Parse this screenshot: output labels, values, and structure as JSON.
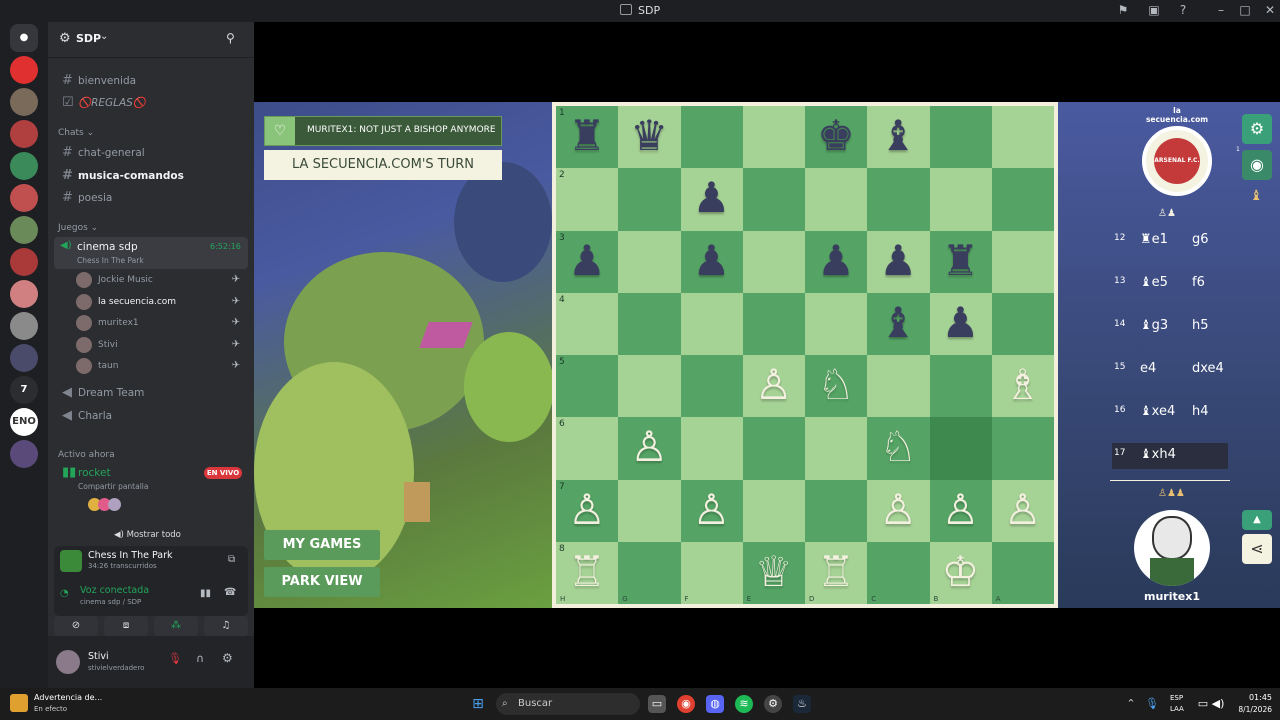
{
  "window": {
    "title": "SDP"
  },
  "server": {
    "name": "SDP"
  },
  "channels": {
    "top": [
      {
        "label": "bienvenida",
        "type": "text"
      },
      {
        "label": "🚫REGLAS🚫",
        "type": "rules"
      }
    ],
    "category_chats": "Chats",
    "chats": [
      {
        "label": "chat-general"
      },
      {
        "label": "musica-comandos"
      },
      {
        "label": "poesia"
      }
    ],
    "category_juegos": "Juegos",
    "voice_active": {
      "label": "cinema sdp",
      "sub": "Chess In The Park",
      "time": "6:52:16"
    },
    "voice_users": [
      {
        "name": "Jockie Music"
      },
      {
        "name": "la secuencia.com"
      },
      {
        "name": "muritex1"
      },
      {
        "name": "Stivi"
      },
      {
        "name": "taun"
      }
    ],
    "other_voice": [
      {
        "label": "Dream Team"
      },
      {
        "label": "Charla"
      }
    ],
    "active_header": "Activo ahora",
    "active_channel": {
      "label": "rocket",
      "sub": "Compartir pantalla",
      "badge": "EN VIVO"
    },
    "show_all": "Mostrar todo"
  },
  "activity": {
    "title": "Chess In The Park",
    "sub": "34:26 transcurridos"
  },
  "voice_status": {
    "title": "Voz conectada",
    "sub": "cinema sdp / SDP"
  },
  "user": {
    "name": "Stivi",
    "tag": "stivielverdadero"
  },
  "servers": [
    {
      "label": "",
      "color": "#e03030"
    },
    {
      "label": "",
      "color": "#7a6a5a"
    },
    {
      "label": "",
      "color": "#b04040"
    },
    {
      "label": "",
      "color": "#3a8a5a"
    },
    {
      "label": "",
      "color": "#c05050"
    },
    {
      "label": "",
      "color": "#6a8a5a"
    },
    {
      "label": "",
      "color": "#aa3a3a"
    },
    {
      "label": "",
      "color": "#d08080"
    },
    {
      "label": "",
      "color": "#8a8a8a"
    },
    {
      "label": "",
      "color": "#4a4a6a"
    },
    {
      "label": "7",
      "color": "#2b2d31"
    },
    {
      "label": "ENO",
      "color": "#fff"
    },
    {
      "label": "",
      "color": "#5a4a7a"
    }
  ],
  "game": {
    "notification": "MURITEX1: NOT JUST A BISHOP ANYMORE",
    "turn": "LA SECUENCIA.COM'S TURN",
    "my_games": "MY GAMES",
    "park_view": "PARK VIEW",
    "player_top": "la secuencia.com",
    "player_bottom": "muritex1",
    "crest_text": "ARSENAL F.C.",
    "badge_num": "1",
    "ranks": [
      "1",
      "2",
      "3",
      "4",
      "5",
      "6",
      "7",
      "8"
    ],
    "files": [
      "H",
      "G",
      "F",
      "E",
      "D",
      "C",
      "B",
      "A"
    ],
    "pieces": [
      {
        "r": 0,
        "c": 0,
        "p": "♜",
        "col": "b"
      },
      {
        "r": 0,
        "c": 1,
        "p": "♛",
        "col": "b"
      },
      {
        "r": 0,
        "c": 4,
        "p": "♚",
        "col": "b"
      },
      {
        "r": 0,
        "c": 5,
        "p": "♝",
        "col": "b"
      },
      {
        "r": 1,
        "c": 2,
        "p": "♟",
        "col": "b"
      },
      {
        "r": 2,
        "c": 0,
        "p": "♟",
        "col": "b"
      },
      {
        "r": 2,
        "c": 2,
        "p": "♟",
        "col": "b"
      },
      {
        "r": 2,
        "c": 4,
        "p": "♟",
        "col": "b"
      },
      {
        "r": 2,
        "c": 5,
        "p": "♟",
        "col": "b"
      },
      {
        "r": 2,
        "c": 6,
        "p": "♜",
        "col": "b"
      },
      {
        "r": 3,
        "c": 5,
        "p": "♝",
        "col": "b"
      },
      {
        "r": 3,
        "c": 6,
        "p": "♟",
        "col": "b"
      },
      {
        "r": 4,
        "c": 3,
        "p": "♙",
        "col": "w"
      },
      {
        "r": 4,
        "c": 4,
        "p": "♘",
        "col": "w"
      },
      {
        "r": 4,
        "c": 7,
        "p": "♗",
        "col": "w"
      },
      {
        "r": 5,
        "c": 1,
        "p": "♙",
        "col": "w"
      },
      {
        "r": 5,
        "c": 5,
        "p": "♘",
        "col": "w"
      },
      {
        "r": 6,
        "c": 0,
        "p": "♙",
        "col": "w"
      },
      {
        "r": 6,
        "c": 2,
        "p": "♙",
        "col": "w"
      },
      {
        "r": 6,
        "c": 5,
        "p": "♙",
        "col": "w"
      },
      {
        "r": 6,
        "c": 6,
        "p": "♙",
        "col": "w"
      },
      {
        "r": 6,
        "c": 7,
        "p": "♙",
        "col": "w"
      },
      {
        "r": 7,
        "c": 0,
        "p": "♖",
        "col": "w"
      },
      {
        "r": 7,
        "c": 3,
        "p": "♕",
        "col": "w"
      },
      {
        "r": 7,
        "c": 4,
        "p": "♖",
        "col": "w"
      },
      {
        "r": 7,
        "c": 6,
        "p": "♔",
        "col": "w"
      }
    ],
    "highlight": {
      "r": 5,
      "c": 6
    },
    "moves": [
      {
        "n": "12",
        "w": "♜e1",
        "b": "g6"
      },
      {
        "n": "13",
        "w": "♝e5",
        "b": "f6"
      },
      {
        "n": "14",
        "w": "♝g3",
        "b": "h5"
      },
      {
        "n": "15",
        "w": "e4",
        "b": "dxe4"
      },
      {
        "n": "16",
        "w": "♝xe4",
        "b": "h4"
      },
      {
        "n": "17",
        "w": "♝xh4",
        "b": ""
      }
    ]
  },
  "taskbar": {
    "alert_title": "Advertencia de...",
    "alert_sub": "En efecto",
    "search": "Buscar",
    "lang": "ESP",
    "lang2": "LAA",
    "time": "01:45",
    "date": "8/1/2026"
  },
  "colors": {
    "board_light": "#a5d295",
    "board_dark": "#55a465",
    "accent": "#5a9a5a",
    "live": "#da373c"
  }
}
